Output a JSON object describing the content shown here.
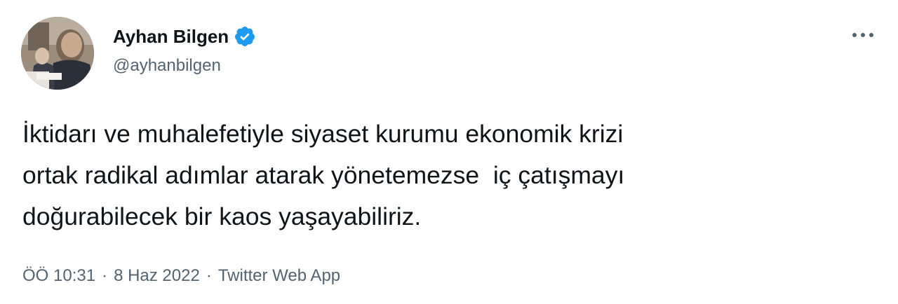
{
  "author": {
    "display_name": "Ayhan Bilgen",
    "handle": "@ayhanbilgen",
    "verified": true
  },
  "tweet": {
    "lines": [
      "İktidarı ve muhalefetiyle siyaset kurumu ekonomik krizi",
      "ortak radikal adımlar atarak yönetemezse  iç çatışmayı",
      "doğurabilecek bir kaos yaşayabiliriz."
    ]
  },
  "meta": {
    "time": "ÖÖ 10:31",
    "separator": "·",
    "date": "8 Haz 2022",
    "source": "Twitter Web App"
  },
  "icons": {
    "verified": "verified-badge-icon",
    "more": "more-horizontal-icon"
  },
  "colors": {
    "accent": "#1d9bf0",
    "text": "#0f1419",
    "secondary": "#536471"
  }
}
